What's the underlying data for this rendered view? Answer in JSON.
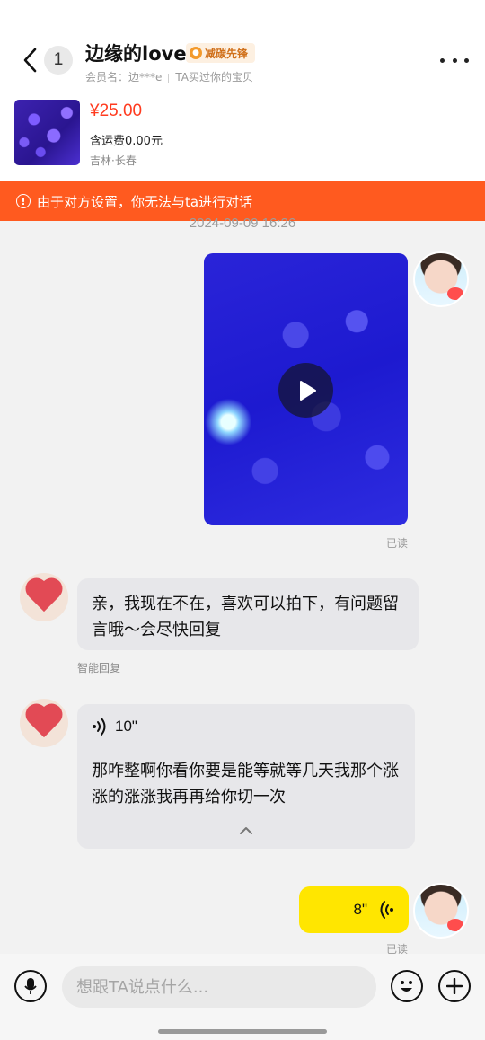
{
  "header": {
    "unread_count": "1",
    "contact_name": "边缘的love",
    "tag_label": "减碳先锋",
    "member_label": "会员名：边***e",
    "purchase_note": "TA买过你的宝贝"
  },
  "product": {
    "price": "¥25.00",
    "shipping": "含运费0.00元",
    "location": "吉林·长春"
  },
  "banner": {
    "text": "由于对方设置，你无法与ta进行对话"
  },
  "chat": {
    "timestamp": "2024-09-09 16:26",
    "read_label_1": "已读",
    "message_1": "亲，我现在不在，喜欢可以拍下，有问题留言哦～会尽快回复",
    "auto_reply_label": "智能回复",
    "voice_1_duration": "10\"",
    "voice_1_transcript": "那咋整啊你看你要是能等就等几天我那个涨涨的涨涨我再再给你切一次",
    "voice_2_duration": "8\"",
    "read_label_2": "已读"
  },
  "composer": {
    "placeholder": "想跟TA说点什么..."
  },
  "colors": {
    "accent_orange": "#ff5a1f",
    "price_red": "#ff3b1f",
    "my_bubble_yellow": "#ffe600",
    "other_bubble_gray": "#e7e7ea"
  }
}
